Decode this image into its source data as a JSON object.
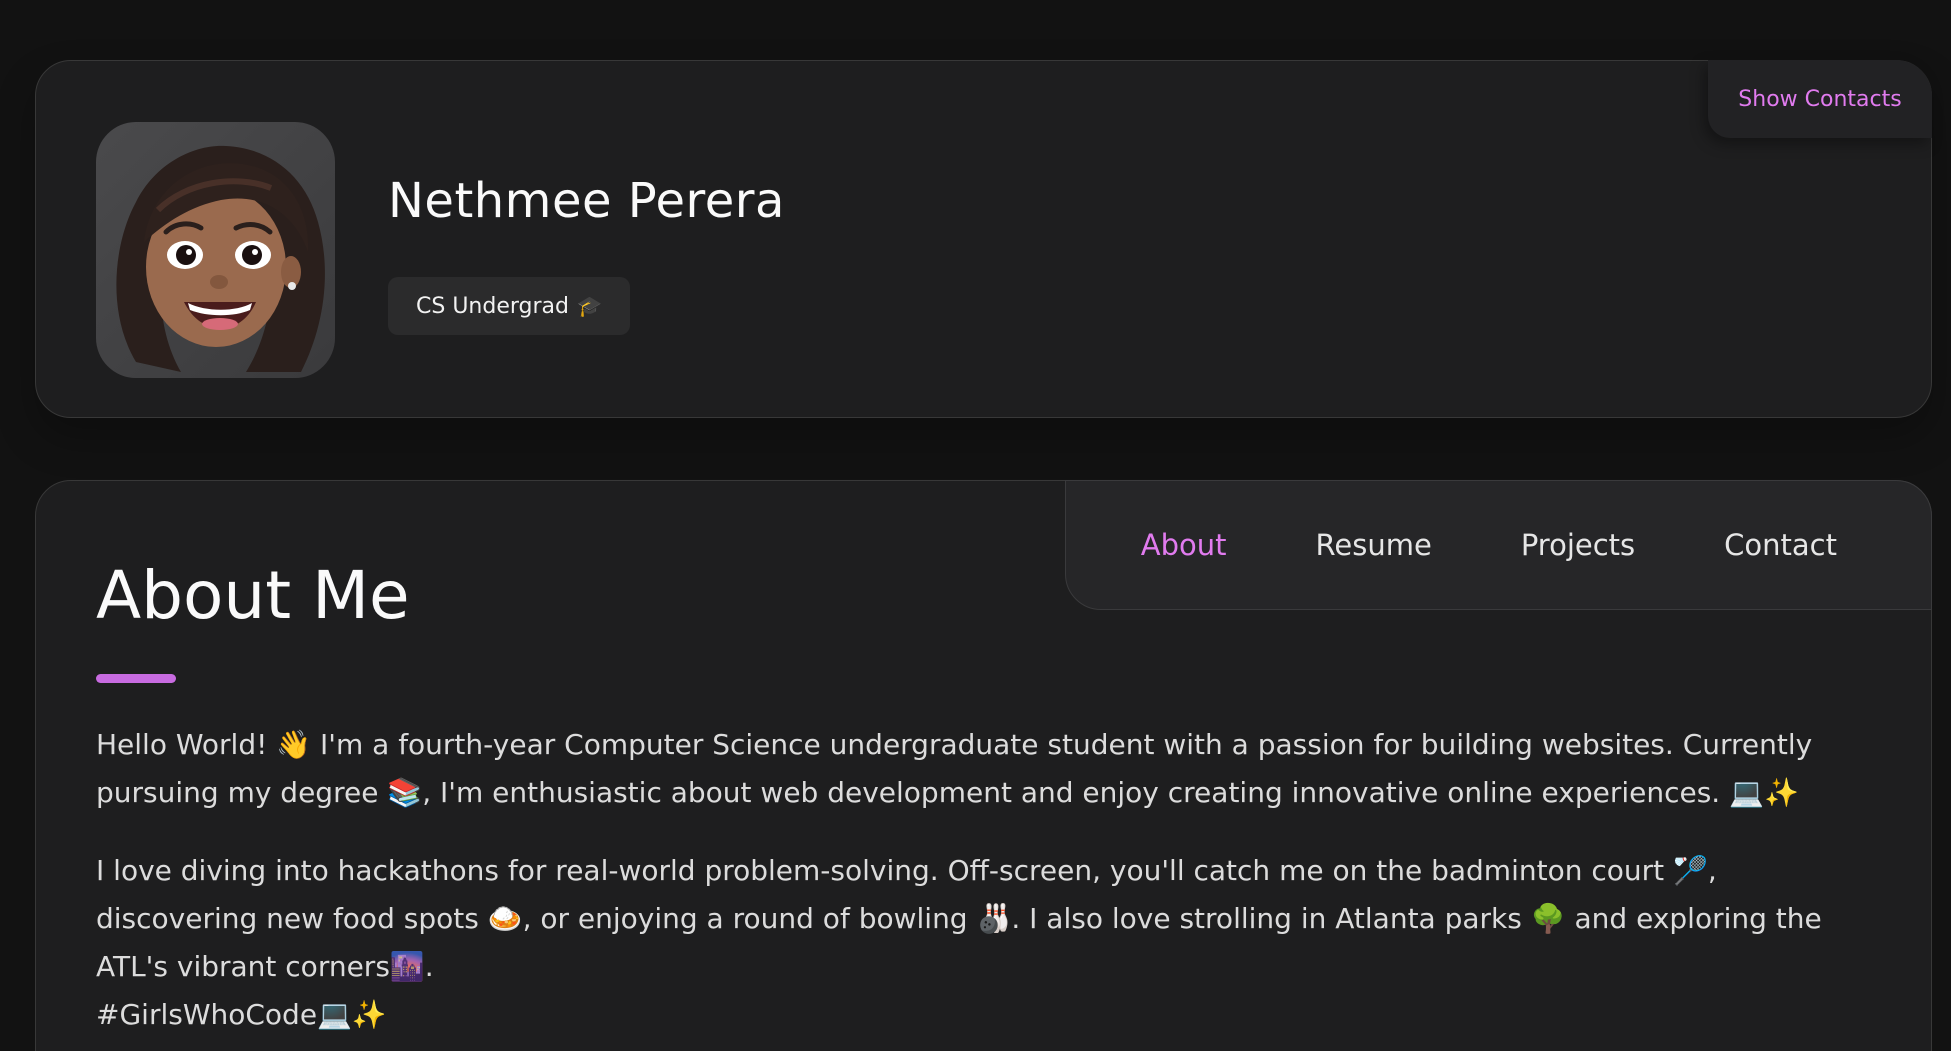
{
  "profile": {
    "show_contacts_label": "Show Contacts",
    "name": "Nethmee Perera",
    "title": "CS Undergrad",
    "title_emoji": "🎓"
  },
  "navbar": {
    "items": [
      {
        "label": "About",
        "active": true
      },
      {
        "label": "Resume",
        "active": false
      },
      {
        "label": "Projects",
        "active": false
      },
      {
        "label": "Contact",
        "active": false
      }
    ]
  },
  "about": {
    "title": "About Me",
    "paragraph_1": "Hello World! 👋 I'm a fourth-year Computer Science undergraduate student with a passion for building websites. Currently pursuing my degree 📚, I'm enthusiastic about web development and enjoy creating innovative online experiences. 💻✨",
    "paragraph_2": "I love diving into hackathons for real-world problem-solving. Off-screen, you'll catch me on the badminton court 🏸, discovering new food spots 🍛, or enjoying a round of bowling 🎳. I also love strolling in Atlanta parks 🌳 and exploring the ATL's vibrant corners🌆.",
    "hashtag": "#GirlsWhoCode💻✨"
  },
  "colors": {
    "accent": "#e17bef",
    "background": "#121212",
    "card": "#1e1e1f"
  }
}
